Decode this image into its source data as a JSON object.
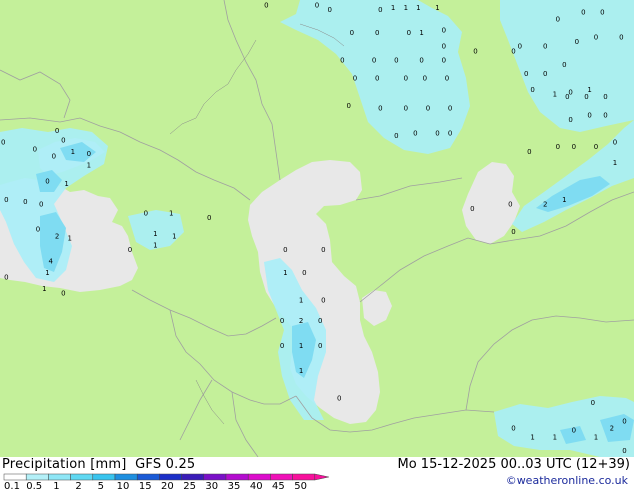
{
  "header": {
    "product": "Precipitation [mm]",
    "model": "GFS 0.25",
    "valid": "Mo 15-12-2025 00..03 UTC (12+39)",
    "credit": "©weatheronline.co.uk"
  },
  "legend": {
    "labels": [
      "0.1",
      "0.5",
      "1",
      "2",
      "5",
      "10",
      "15",
      "20",
      "25",
      "30",
      "35",
      "40",
      "45",
      "50"
    ],
    "colors": [
      "#ffffff",
      "#b4f0f8",
      "#8ee6f6",
      "#5fd8f2",
      "#38c4ee",
      "#1e8fe0",
      "#1a5ad6",
      "#1c2fc8",
      "#3a1cb8",
      "#7a10c8",
      "#b40cd0",
      "#dc0ccc",
      "#f010b8",
      "#f8109c"
    ]
  },
  "map": {
    "colors": {
      "land": "#c4f09a",
      "water": "#e8e8e8",
      "border": "#a0a0a0",
      "precip_light": "#a8eef8",
      "precip_med": "#7fdcf2"
    },
    "values": [
      {
        "x": 0.42,
        "y": 0.01,
        "v": "0"
      },
      {
        "x": 0.5,
        "y": 0.01,
        "v": "0"
      },
      {
        "x": 0.52,
        "y": 0.02,
        "v": "0"
      },
      {
        "x": 0.6,
        "y": 0.02,
        "v": "0"
      },
      {
        "x": 0.62,
        "y": 0.015,
        "v": "1"
      },
      {
        "x": 0.64,
        "y": 0.015,
        "v": "1"
      },
      {
        "x": 0.66,
        "y": 0.015,
        "v": "1"
      },
      {
        "x": 0.69,
        "y": 0.015,
        "v": "1"
      },
      {
        "x": 0.665,
        "y": 0.07,
        "v": "1"
      },
      {
        "x": 0.645,
        "y": 0.07,
        "v": "0"
      },
      {
        "x": 0.595,
        "y": 0.07,
        "v": "0"
      },
      {
        "x": 0.555,
        "y": 0.07,
        "v": "0"
      },
      {
        "x": 0.7,
        "y": 0.065,
        "v": "0"
      },
      {
        "x": 0.7,
        "y": 0.1,
        "v": "0"
      },
      {
        "x": 0.88,
        "y": 0.04,
        "v": "0"
      },
      {
        "x": 0.92,
        "y": 0.025,
        "v": "0"
      },
      {
        "x": 0.95,
        "y": 0.025,
        "v": "0"
      },
      {
        "x": 0.94,
        "y": 0.08,
        "v": "0"
      },
      {
        "x": 0.91,
        "y": 0.09,
        "v": "0"
      },
      {
        "x": 0.86,
        "y": 0.1,
        "v": "0"
      },
      {
        "x": 0.82,
        "y": 0.1,
        "v": "0"
      },
      {
        "x": 0.81,
        "y": 0.11,
        "v": "0"
      },
      {
        "x": 0.98,
        "y": 0.08,
        "v": "0"
      },
      {
        "x": 0.75,
        "y": 0.11,
        "v": "0"
      },
      {
        "x": 0.54,
        "y": 0.13,
        "v": "0"
      },
      {
        "x": 0.59,
        "y": 0.13,
        "v": "0"
      },
      {
        "x": 0.625,
        "y": 0.13,
        "v": "0"
      },
      {
        "x": 0.665,
        "y": 0.13,
        "v": "0"
      },
      {
        "x": 0.7,
        "y": 0.13,
        "v": "0"
      },
      {
        "x": 0.89,
        "y": 0.14,
        "v": "0"
      },
      {
        "x": 0.86,
        "y": 0.16,
        "v": "0"
      },
      {
        "x": 0.83,
        "y": 0.16,
        "v": "0"
      },
      {
        "x": 0.56,
        "y": 0.17,
        "v": "0"
      },
      {
        "x": 0.595,
        "y": 0.17,
        "v": "0"
      },
      {
        "x": 0.64,
        "y": 0.17,
        "v": "0"
      },
      {
        "x": 0.67,
        "y": 0.17,
        "v": "0"
      },
      {
        "x": 0.705,
        "y": 0.17,
        "v": "0"
      },
      {
        "x": 0.84,
        "y": 0.195,
        "v": "0"
      },
      {
        "x": 0.875,
        "y": 0.205,
        "v": "1"
      },
      {
        "x": 0.9,
        "y": 0.2,
        "v": "0"
      },
      {
        "x": 0.93,
        "y": 0.195,
        "v": "1"
      },
      {
        "x": 0.955,
        "y": 0.21,
        "v": "0"
      },
      {
        "x": 0.895,
        "y": 0.21,
        "v": "0"
      },
      {
        "x": 0.925,
        "y": 0.21,
        "v": "0"
      },
      {
        "x": 0.6,
        "y": 0.235,
        "v": "0"
      },
      {
        "x": 0.64,
        "y": 0.235,
        "v": "0"
      },
      {
        "x": 0.675,
        "y": 0.235,
        "v": "0"
      },
      {
        "x": 0.71,
        "y": 0.235,
        "v": "0"
      },
      {
        "x": 0.55,
        "y": 0.23,
        "v": "0"
      },
      {
        "x": 0.9,
        "y": 0.26,
        "v": "0"
      },
      {
        "x": 0.93,
        "y": 0.25,
        "v": "0"
      },
      {
        "x": 0.955,
        "y": 0.25,
        "v": "0"
      },
      {
        "x": 0.625,
        "y": 0.295,
        "v": "0"
      },
      {
        "x": 0.655,
        "y": 0.29,
        "v": "0"
      },
      {
        "x": 0.69,
        "y": 0.29,
        "v": "0"
      },
      {
        "x": 0.71,
        "y": 0.29,
        "v": "0"
      },
      {
        "x": 0.88,
        "y": 0.32,
        "v": "0"
      },
      {
        "x": 0.905,
        "y": 0.32,
        "v": "0"
      },
      {
        "x": 0.94,
        "y": 0.32,
        "v": "0"
      },
      {
        "x": 0.97,
        "y": 0.31,
        "v": "0"
      },
      {
        "x": 0.835,
        "y": 0.33,
        "v": "0"
      },
      {
        "x": 0.97,
        "y": 0.355,
        "v": "1"
      },
      {
        "x": 0.745,
        "y": 0.455,
        "v": "0"
      },
      {
        "x": 0.805,
        "y": 0.445,
        "v": "0"
      },
      {
        "x": 0.86,
        "y": 0.445,
        "v": "2"
      },
      {
        "x": 0.89,
        "y": 0.435,
        "v": "1"
      },
      {
        "x": 0.81,
        "y": 0.505,
        "v": "0"
      },
      {
        "x": 0.09,
        "y": 0.285,
        "v": "0"
      },
      {
        "x": 0.1,
        "y": 0.305,
        "v": "0"
      },
      {
        "x": 0.115,
        "y": 0.33,
        "v": "1"
      },
      {
        "x": 0.085,
        "y": 0.34,
        "v": "0"
      },
      {
        "x": 0.14,
        "y": 0.335,
        "v": "0"
      },
      {
        "x": 0.075,
        "y": 0.395,
        "v": "0"
      },
      {
        "x": 0.105,
        "y": 0.4,
        "v": "1"
      },
      {
        "x": 0.14,
        "y": 0.36,
        "v": "1"
      },
      {
        "x": 0.055,
        "y": 0.325,
        "v": "0"
      },
      {
        "x": 0.005,
        "y": 0.31,
        "v": "0"
      },
      {
        "x": 0.01,
        "y": 0.435,
        "v": "0"
      },
      {
        "x": 0.04,
        "y": 0.44,
        "v": "0"
      },
      {
        "x": 0.065,
        "y": 0.445,
        "v": "0"
      },
      {
        "x": 0.06,
        "y": 0.5,
        "v": "0"
      },
      {
        "x": 0.09,
        "y": 0.515,
        "v": "2"
      },
      {
        "x": 0.11,
        "y": 0.52,
        "v": "1"
      },
      {
        "x": 0.08,
        "y": 0.57,
        "v": "4"
      },
      {
        "x": 0.075,
        "y": 0.595,
        "v": "1"
      },
      {
        "x": 0.01,
        "y": 0.605,
        "v": "0"
      },
      {
        "x": 0.07,
        "y": 0.63,
        "v": "1"
      },
      {
        "x": 0.1,
        "y": 0.64,
        "v": "0"
      },
      {
        "x": 0.205,
        "y": 0.545,
        "v": "0"
      },
      {
        "x": 0.245,
        "y": 0.51,
        "v": "1"
      },
      {
        "x": 0.245,
        "y": 0.535,
        "v": "1"
      },
      {
        "x": 0.27,
        "y": 0.465,
        "v": "1"
      },
      {
        "x": 0.275,
        "y": 0.515,
        "v": "1"
      },
      {
        "x": 0.33,
        "y": 0.475,
        "v": "0"
      },
      {
        "x": 0.23,
        "y": 0.465,
        "v": "0"
      },
      {
        "x": 0.45,
        "y": 0.545,
        "v": "0"
      },
      {
        "x": 0.51,
        "y": 0.545,
        "v": "0"
      },
      {
        "x": 0.45,
        "y": 0.595,
        "v": "1"
      },
      {
        "x": 0.48,
        "y": 0.595,
        "v": "0"
      },
      {
        "x": 0.475,
        "y": 0.655,
        "v": "1"
      },
      {
        "x": 0.51,
        "y": 0.655,
        "v": "0"
      },
      {
        "x": 0.445,
        "y": 0.7,
        "v": "0"
      },
      {
        "x": 0.475,
        "y": 0.7,
        "v": "2"
      },
      {
        "x": 0.505,
        "y": 0.7,
        "v": "0"
      },
      {
        "x": 0.445,
        "y": 0.755,
        "v": "0"
      },
      {
        "x": 0.475,
        "y": 0.755,
        "v": "1"
      },
      {
        "x": 0.505,
        "y": 0.755,
        "v": "0"
      },
      {
        "x": 0.475,
        "y": 0.81,
        "v": "1"
      },
      {
        "x": 0.535,
        "y": 0.87,
        "v": "0"
      },
      {
        "x": 0.81,
        "y": 0.935,
        "v": "0"
      },
      {
        "x": 0.84,
        "y": 0.955,
        "v": "1"
      },
      {
        "x": 0.875,
        "y": 0.955,
        "v": "1"
      },
      {
        "x": 0.905,
        "y": 0.94,
        "v": "0"
      },
      {
        "x": 0.935,
        "y": 0.88,
        "v": "0"
      },
      {
        "x": 0.965,
        "y": 0.935,
        "v": "2"
      },
      {
        "x": 0.94,
        "y": 0.955,
        "v": "1"
      },
      {
        "x": 0.985,
        "y": 0.92,
        "v": "0"
      },
      {
        "x": 0.985,
        "y": 0.985,
        "v": "0"
      }
    ]
  }
}
